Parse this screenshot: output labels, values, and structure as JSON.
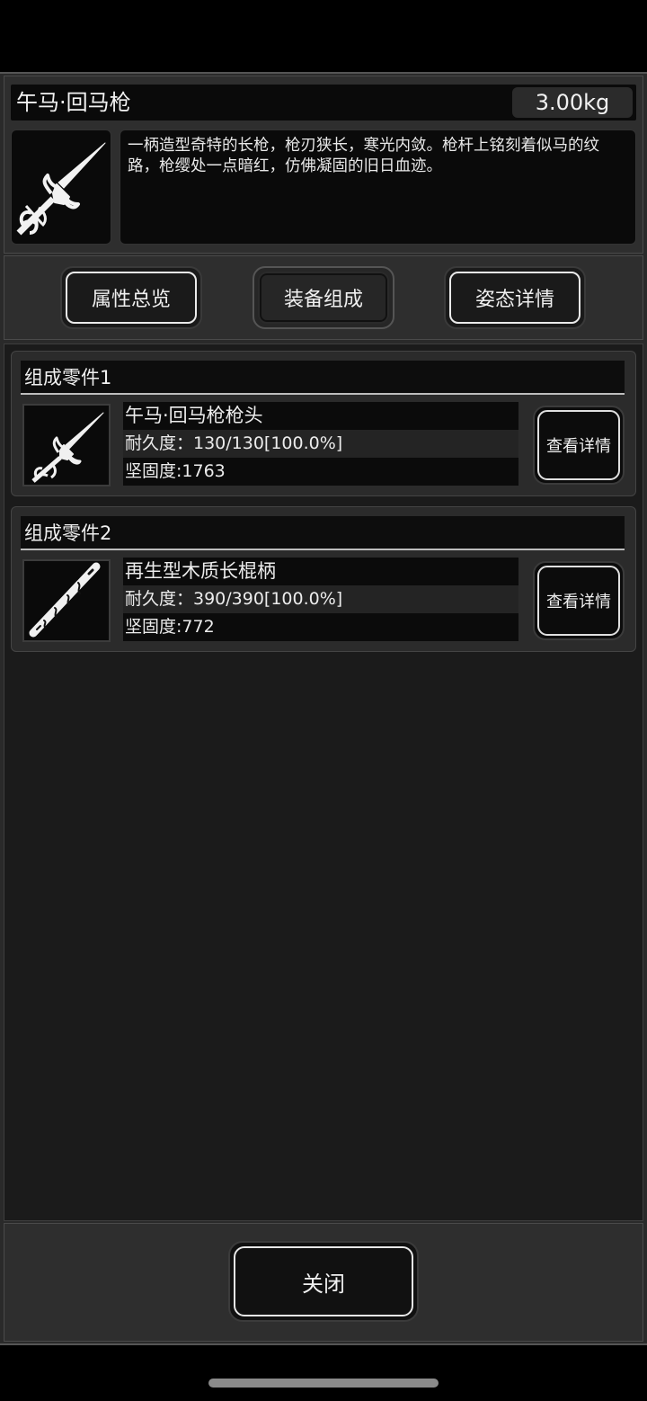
{
  "item": {
    "title": "午马·回马枪",
    "weight": "3.00kg",
    "description": "一柄造型奇特的长枪，枪刃狭长，寒光内敛。枪杆上铭刻着似马的纹路，枪缨处一点暗红，仿佛凝固的旧日血迹。",
    "icon": "spear-icon"
  },
  "tabs": [
    {
      "label": "属性总览",
      "active": false
    },
    {
      "label": "装备组成",
      "active": true
    },
    {
      "label": "姿态详情",
      "active": false
    }
  ],
  "parts": [
    {
      "header": "组成零件1",
      "name": "午马·回马枪枪头",
      "durability": "耐久度：130/130[100.0%]",
      "solidity": "坚固度:1763",
      "button": "查看详情",
      "icon": "spearhead-icon"
    },
    {
      "header": "组成零件2",
      "name": "再生型木质长棍柄",
      "durability": "耐久度：390/390[100.0%]",
      "solidity": "坚固度:772",
      "button": "查看详情",
      "icon": "staff-handle-icon"
    }
  ],
  "footer": {
    "close_label": "关闭"
  }
}
